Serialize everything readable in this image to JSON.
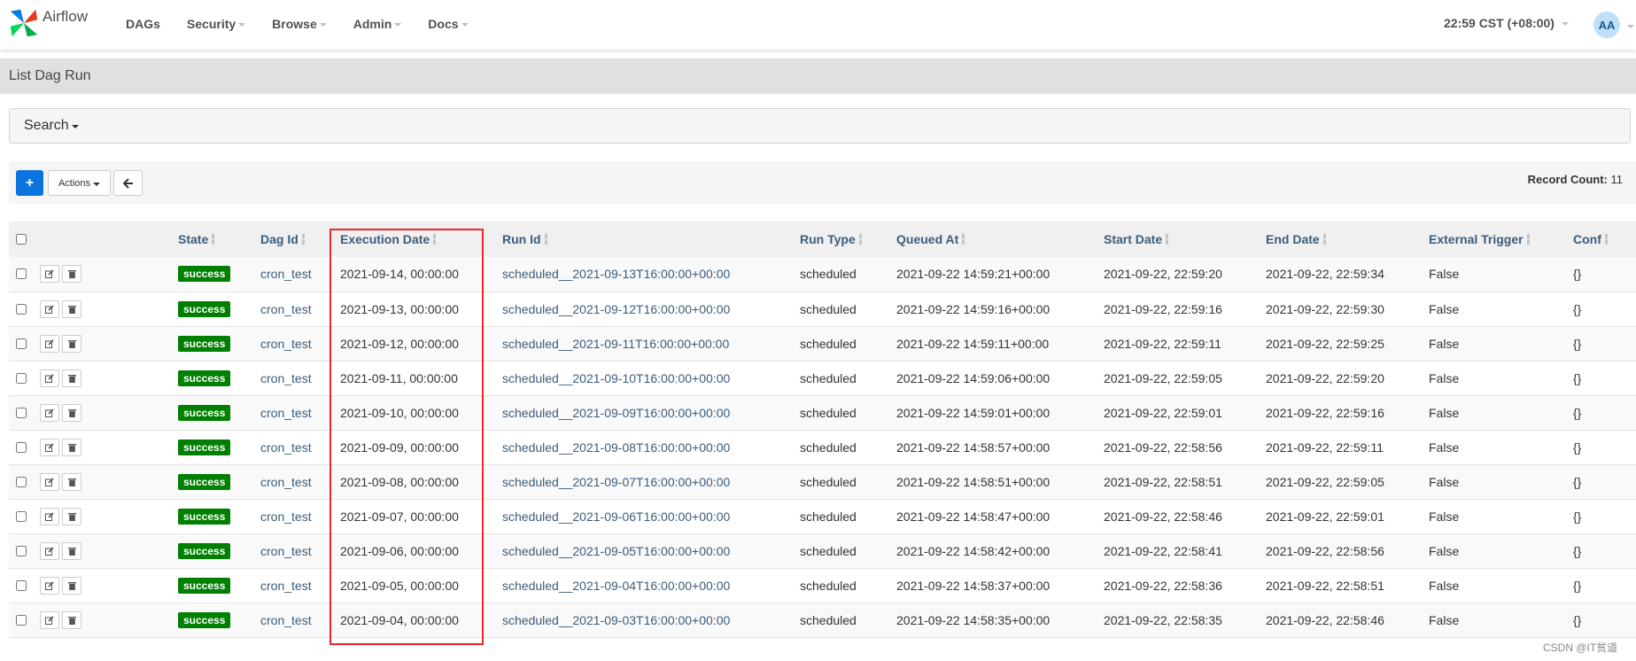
{
  "app": {
    "name": "Airflow"
  },
  "nav": {
    "items": [
      {
        "label": "DAGs",
        "dropdown": false
      },
      {
        "label": "Security",
        "dropdown": true
      },
      {
        "label": "Browse",
        "dropdown": true
      },
      {
        "label": "Admin",
        "dropdown": true
      },
      {
        "label": "Docs",
        "dropdown": true
      }
    ],
    "clock": "22:59 CST (+08:00)",
    "user_initials": "AA"
  },
  "page": {
    "title": "List Dag Run"
  },
  "search": {
    "label": "Search"
  },
  "toolbar": {
    "add_label": "+",
    "actions_label": "Actions",
    "record_count_label": "Record Count:",
    "record_count": "11"
  },
  "table": {
    "headers": [
      "State",
      "Dag Id",
      "Execution Date",
      "Run Id",
      "Run Type",
      "Queued At",
      "Start Date",
      "End Date",
      "External Trigger",
      "Conf"
    ],
    "rows": [
      [
        "success",
        "cron_test",
        "2021-09-14, 00:00:00",
        "scheduled__2021-09-13T16:00:00+00:00",
        "scheduled",
        "2021-09-22 14:59:21+00:00",
        "2021-09-22, 22:59:20",
        "2021-09-22, 22:59:34",
        "False",
        "{}"
      ],
      [
        "success",
        "cron_test",
        "2021-09-13, 00:00:00",
        "scheduled__2021-09-12T16:00:00+00:00",
        "scheduled",
        "2021-09-22 14:59:16+00:00",
        "2021-09-22, 22:59:16",
        "2021-09-22, 22:59:30",
        "False",
        "{}"
      ],
      [
        "success",
        "cron_test",
        "2021-09-12, 00:00:00",
        "scheduled__2021-09-11T16:00:00+00:00",
        "scheduled",
        "2021-09-22 14:59:11+00:00",
        "2021-09-22, 22:59:11",
        "2021-09-22, 22:59:25",
        "False",
        "{}"
      ],
      [
        "success",
        "cron_test",
        "2021-09-11, 00:00:00",
        "scheduled__2021-09-10T16:00:00+00:00",
        "scheduled",
        "2021-09-22 14:59:06+00:00",
        "2021-09-22, 22:59:05",
        "2021-09-22, 22:59:20",
        "False",
        "{}"
      ],
      [
        "success",
        "cron_test",
        "2021-09-10, 00:00:00",
        "scheduled__2021-09-09T16:00:00+00:00",
        "scheduled",
        "2021-09-22 14:59:01+00:00",
        "2021-09-22, 22:59:01",
        "2021-09-22, 22:59:16",
        "False",
        "{}"
      ],
      [
        "success",
        "cron_test",
        "2021-09-09, 00:00:00",
        "scheduled__2021-09-08T16:00:00+00:00",
        "scheduled",
        "2021-09-22 14:58:57+00:00",
        "2021-09-22, 22:58:56",
        "2021-09-22, 22:59:11",
        "False",
        "{}"
      ],
      [
        "success",
        "cron_test",
        "2021-09-08, 00:00:00",
        "scheduled__2021-09-07T16:00:00+00:00",
        "scheduled",
        "2021-09-22 14:58:51+00:00",
        "2021-09-22, 22:58:51",
        "2021-09-22, 22:59:05",
        "False",
        "{}"
      ],
      [
        "success",
        "cron_test",
        "2021-09-07, 00:00:00",
        "scheduled__2021-09-06T16:00:00+00:00",
        "scheduled",
        "2021-09-22 14:58:47+00:00",
        "2021-09-22, 22:58:46",
        "2021-09-22, 22:59:01",
        "False",
        "{}"
      ],
      [
        "success",
        "cron_test",
        "2021-09-06, 00:00:00",
        "scheduled__2021-09-05T16:00:00+00:00",
        "scheduled",
        "2021-09-22 14:58:42+00:00",
        "2021-09-22, 22:58:41",
        "2021-09-22, 22:58:56",
        "False",
        "{}"
      ],
      [
        "success",
        "cron_test",
        "2021-09-05, 00:00:00",
        "scheduled__2021-09-04T16:00:00+00:00",
        "scheduled",
        "2021-09-22 14:58:37+00:00",
        "2021-09-22, 22:58:36",
        "2021-09-22, 22:58:51",
        "False",
        "{}"
      ],
      [
        "success",
        "cron_test",
        "2021-09-04, 00:00:00",
        "scheduled__2021-09-03T16:00:00+00:00",
        "scheduled",
        "2021-09-22 14:58:35+00:00",
        "2021-09-22, 22:58:35",
        "2021-09-22, 22:58:46",
        "False",
        "{}"
      ]
    ]
  },
  "watermark": "CSDN @IT贫道",
  "colors": {
    "success": "#008000",
    "primary": "#0b74de",
    "highlight": "#e8292f",
    "link": "#3b5c7a"
  },
  "icons": [
    "airflow-logo-icon",
    "edit-icon",
    "trash-icon",
    "back-arrow-icon",
    "sort-icon"
  ]
}
